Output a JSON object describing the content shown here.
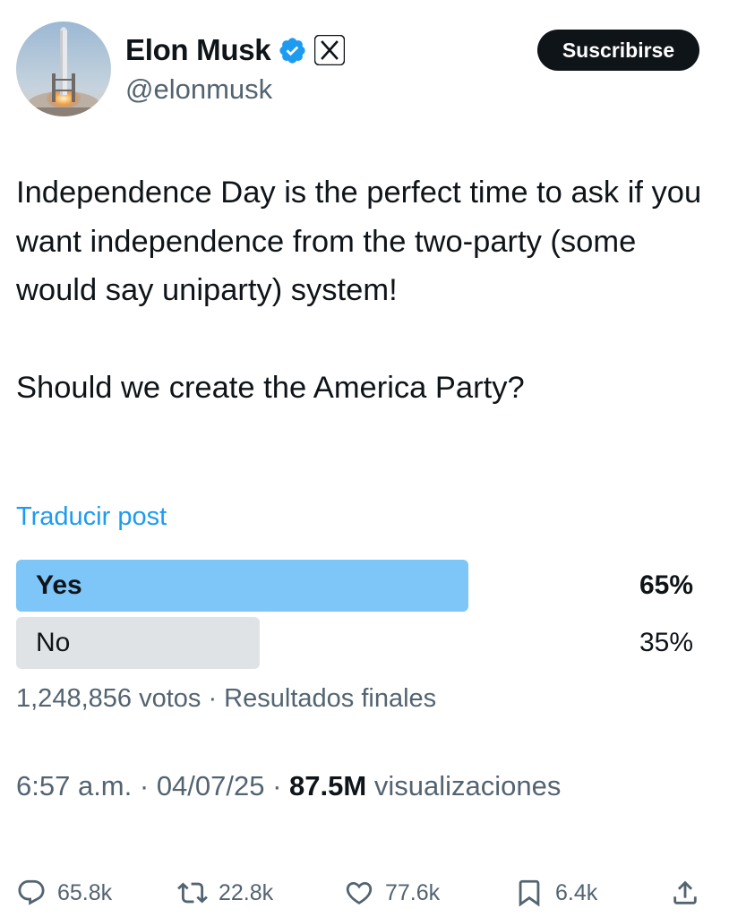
{
  "author": {
    "display_name": "Elon Musk",
    "handle": "@elonmusk",
    "badges": [
      "verified-icon",
      "x-logo-icon"
    ]
  },
  "subscribe": {
    "label": "Suscribirse"
  },
  "post": {
    "paragraph1": "Independence Day is the perfect time to ask if you want independence from the two-party (some would say uniparty) system!",
    "paragraph2": "Should we create the America Party?"
  },
  "translate_label": "Traducir post",
  "poll": {
    "options": [
      {
        "label": "Yes",
        "percent_text": "65%",
        "percent": 65,
        "winner": true
      },
      {
        "label": "No",
        "percent_text": "35%",
        "percent": 35,
        "winner": false
      }
    ],
    "votes_text": "1,248,856 votos",
    "separator": " · ",
    "status_text": "Resultados finales"
  },
  "meta": {
    "time": "6:57 a.m.",
    "date": "04/07/25",
    "views_count": "87.5M",
    "views_label": "visualizaciones",
    "separator": " · "
  },
  "actions": {
    "replies": "65.8k",
    "reposts": "22.8k",
    "likes": "77.6k",
    "bookmarks": "6.4k"
  },
  "colors": {
    "accent": "#1d9bf0",
    "poll_winner_bar": "#7dc6f7",
    "poll_other_bar": "#e0e3e5",
    "text_primary": "#0f1419",
    "text_secondary": "#536471",
    "button_bg": "#0f1419"
  }
}
